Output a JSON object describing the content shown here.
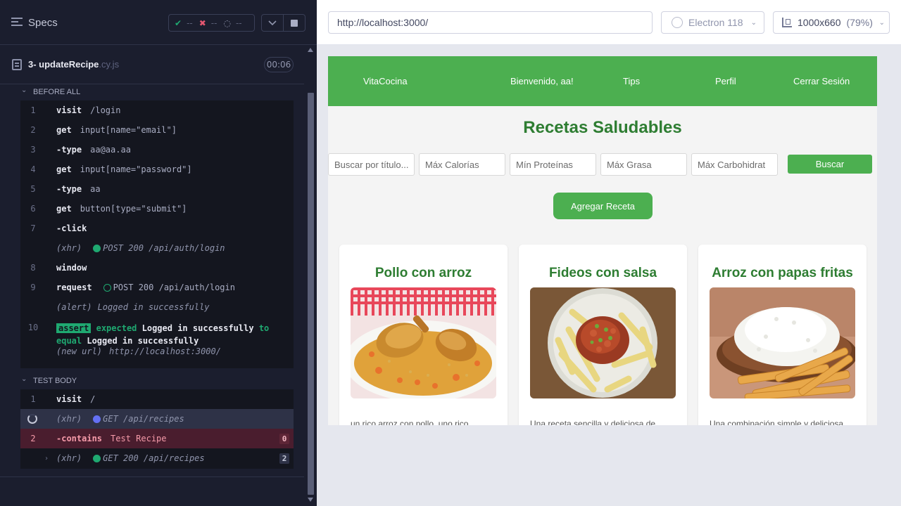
{
  "runner": {
    "title": "Specs",
    "stats": {
      "passed_icon": "check-icon",
      "passed": "--",
      "failed_icon": "x-icon",
      "failed": "--",
      "pending_icon": "spinner-icon",
      "pending": "--"
    },
    "spec": {
      "name": "3- updateRecipe",
      "ext": ".cy.js",
      "duration": "00:06"
    },
    "before_all": {
      "label": "BEFORE ALL",
      "commands": [
        {
          "num": "1",
          "name": "visit",
          "arg": "/login"
        },
        {
          "num": "2",
          "name": "get",
          "arg": "input[name=\"email\"]"
        },
        {
          "num": "3",
          "name": "-type",
          "arg": "aa@aa.aa"
        },
        {
          "num": "4",
          "name": "get",
          "arg": "input[name=\"password\"]"
        },
        {
          "num": "5",
          "name": "-type",
          "arg": "aa"
        },
        {
          "num": "6",
          "name": "get",
          "arg": "button[type=\"submit\"]"
        },
        {
          "num": "7",
          "name": "-click",
          "arg": ""
        }
      ],
      "xhr1": {
        "prefix": "(xhr)",
        "text": "POST 200 /api/auth/login"
      },
      "cmd8": {
        "num": "8",
        "name": "window"
      },
      "cmd9": {
        "num": "9",
        "name": "request",
        "text": "POST 200 /api/auth/login"
      },
      "alert": {
        "prefix": "(alert)",
        "text": "Logged in successfully"
      },
      "assert": {
        "num": "10",
        "badge": "assert",
        "expected": "expected",
        "value1": "Logged in successfully",
        "to": "to",
        "equal": "equal",
        "value2": "Logged in successfully"
      },
      "newurl": {
        "prefix": "(new url)",
        "text": "http://localhost:3000/"
      }
    },
    "test_body": {
      "label": "TEST BODY",
      "visit": {
        "num": "1",
        "name": "visit",
        "arg": "/"
      },
      "xhr_pending": {
        "prefix": "(xhr)",
        "text": "GET /api/recipes"
      },
      "contains": {
        "num": "2",
        "name": "-contains",
        "arg": "Test Recipe",
        "count": "0"
      },
      "xhr_done": {
        "prefix": "(xhr)",
        "text": "GET 200 /api/recipes",
        "count": "2"
      }
    }
  },
  "browser": {
    "url": "http://localhost:3000/",
    "browser_name": "Electron 118",
    "viewport": "1000x660",
    "zoom": "(79%)"
  },
  "app": {
    "nav": {
      "brand": "VitaCocina",
      "welcome": "Bienvenido, aa!",
      "tips": "Tips",
      "profile": "Perfil",
      "logout": "Cerrar Sesión"
    },
    "title": "Recetas Saludables",
    "search": {
      "title_placeholder": "Buscar por título...",
      "cal_placeholder": "Máx Calorías",
      "prot_placeholder": "Mín Proteínas",
      "fat_placeholder": "Máx Grasa",
      "carb_placeholder": "Máx Carbohidrat",
      "button": "Buscar"
    },
    "add_button": "Agregar Receta",
    "recipes": [
      {
        "title": "Pollo con arroz",
        "desc": "un rico arroz con pollo, uno rico"
      },
      {
        "title": "Fideos con salsa",
        "desc": "Una receta sencilla y deliciosa de"
      },
      {
        "title": "Arroz con papas fritas",
        "desc": "Una combinación simple y deliciosa"
      }
    ]
  }
}
